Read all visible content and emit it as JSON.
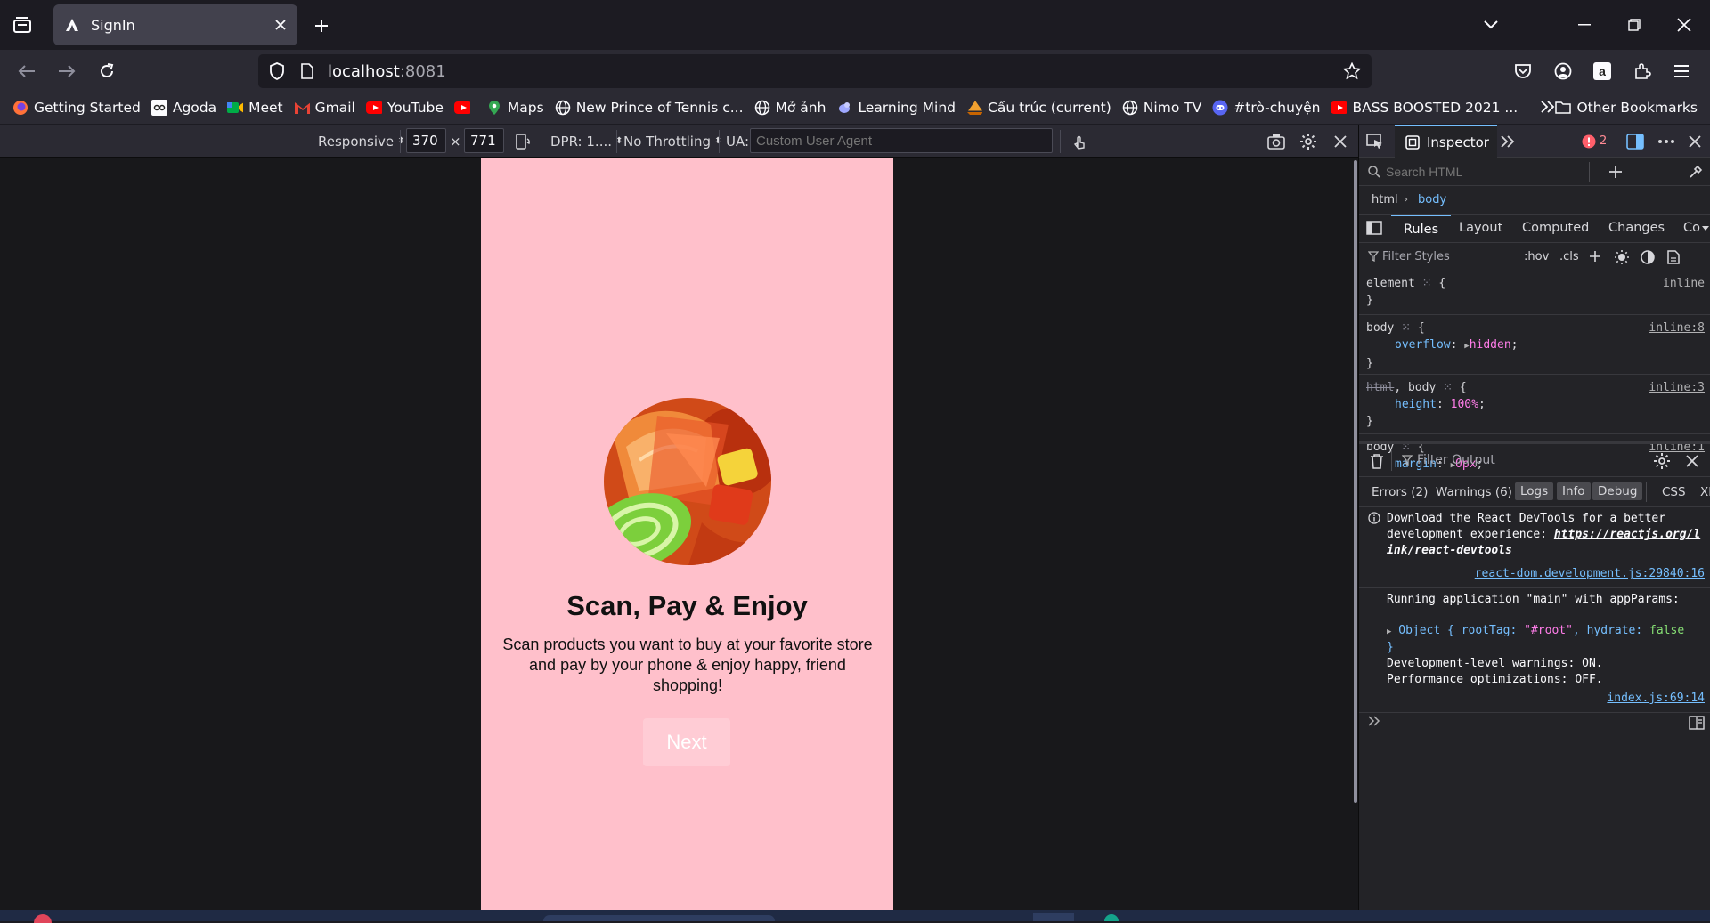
{
  "browser": {
    "tab_title": "SignIn",
    "url_host": "localhost",
    "url_port": ":8081"
  },
  "bookmarks": [
    {
      "label": "Getting Started",
      "icon": "firefox-icon"
    },
    {
      "label": "Agoda",
      "icon": "agoda-icon"
    },
    {
      "label": "Meet",
      "icon": "meet-icon"
    },
    {
      "label": "Gmail",
      "icon": "gmail-icon"
    },
    {
      "label": "YouTube",
      "icon": "youtube-icon"
    },
    {
      "label": "",
      "icon": "youtube-icon"
    },
    {
      "label": "Maps",
      "icon": "maps-icon"
    },
    {
      "label": "New Prince of Tennis c...",
      "icon": "globe-icon"
    },
    {
      "label": "Mở ảnh",
      "icon": "globe-icon"
    },
    {
      "label": "Learning Mind",
      "icon": "bird-icon"
    },
    {
      "label": "Cấu trúc (current)",
      "icon": "ship-icon"
    },
    {
      "label": "Nimo TV",
      "icon": "globe-icon"
    },
    {
      "label": "#trò-chuyện",
      "icon": "discord-icon"
    },
    {
      "label": "BASS BOOSTED 2021 ...",
      "icon": "youtube-icon"
    }
  ],
  "bookmarks_other": "Other Bookmarks",
  "rdm": {
    "device": "Responsive",
    "width": "370",
    "times": "×",
    "height": "771",
    "dpr": "DPR: 1....",
    "throttling": "No Throttling",
    "ua_label": "UA:",
    "ua_placeholder": "Custom User Agent"
  },
  "app": {
    "title": "Scan, Pay & Enjoy",
    "description": "Scan products you want to buy at your favorite store and pay by your phone & enjoy happy, friend shopping!",
    "next_label": "Next"
  },
  "devtools": {
    "inspector_label": "Inspector",
    "error_count": "2",
    "search_placeholder": "Search HTML",
    "breadcrumb": [
      "html",
      "body"
    ],
    "panel_tabs": [
      "Rules",
      "Layout",
      "Computed",
      "Changes",
      "Co"
    ],
    "filter_styles": "Filter Styles",
    "hov": ":hov",
    "cls": ".cls",
    "rules": [
      {
        "selector": "element",
        "open": " {",
        "src": "inline",
        "decls": []
      },
      {
        "selector": "body",
        "open": " {",
        "src": "inline:8",
        "decls": [
          {
            "prop": "overflow",
            "val": "hidden"
          }
        ]
      },
      {
        "selector_strike": "html",
        "selector": ", body",
        "open": " {",
        "src": "inline:3",
        "decls": [
          {
            "prop": "height",
            "val": "100%"
          }
        ]
      },
      {
        "selector": "body",
        "open": " {",
        "src": "inline:1",
        "decls": [
          {
            "prop": "margin",
            "val": "0px"
          }
        ]
      }
    ],
    "filter_output": "Filter Output",
    "console_filters": {
      "errors": "Errors (2)",
      "warnings": "Warnings (6)",
      "logs": "Logs",
      "info": "Info",
      "debug": "Debug",
      "css": "CSS",
      "xhr": "XH"
    },
    "console": {
      "msg1": "Download the React DevTools for a better development experience:",
      "msg1_link": "https://reactjs.org/link/react-devtools",
      "msg1_src": "react-dom.development.js:29840:16",
      "msg2": "Running application \"main\" with appParams:",
      "msg2_obj_prefix": "Object { rootTag:",
      "msg2_obj_root": "\"#root\"",
      "msg2_obj_mid": ", hydrate:",
      "msg2_obj_hydrate": "false",
      "msg2_obj_end": "}",
      "msg3": "Development-level warnings: ON.",
      "msg4": "Performance optimizations: OFF.",
      "msg2_src": "index.js:69:14"
    }
  },
  "colors": {
    "app_background": "#ffc0cb",
    "next_button": "#ffccd5"
  }
}
